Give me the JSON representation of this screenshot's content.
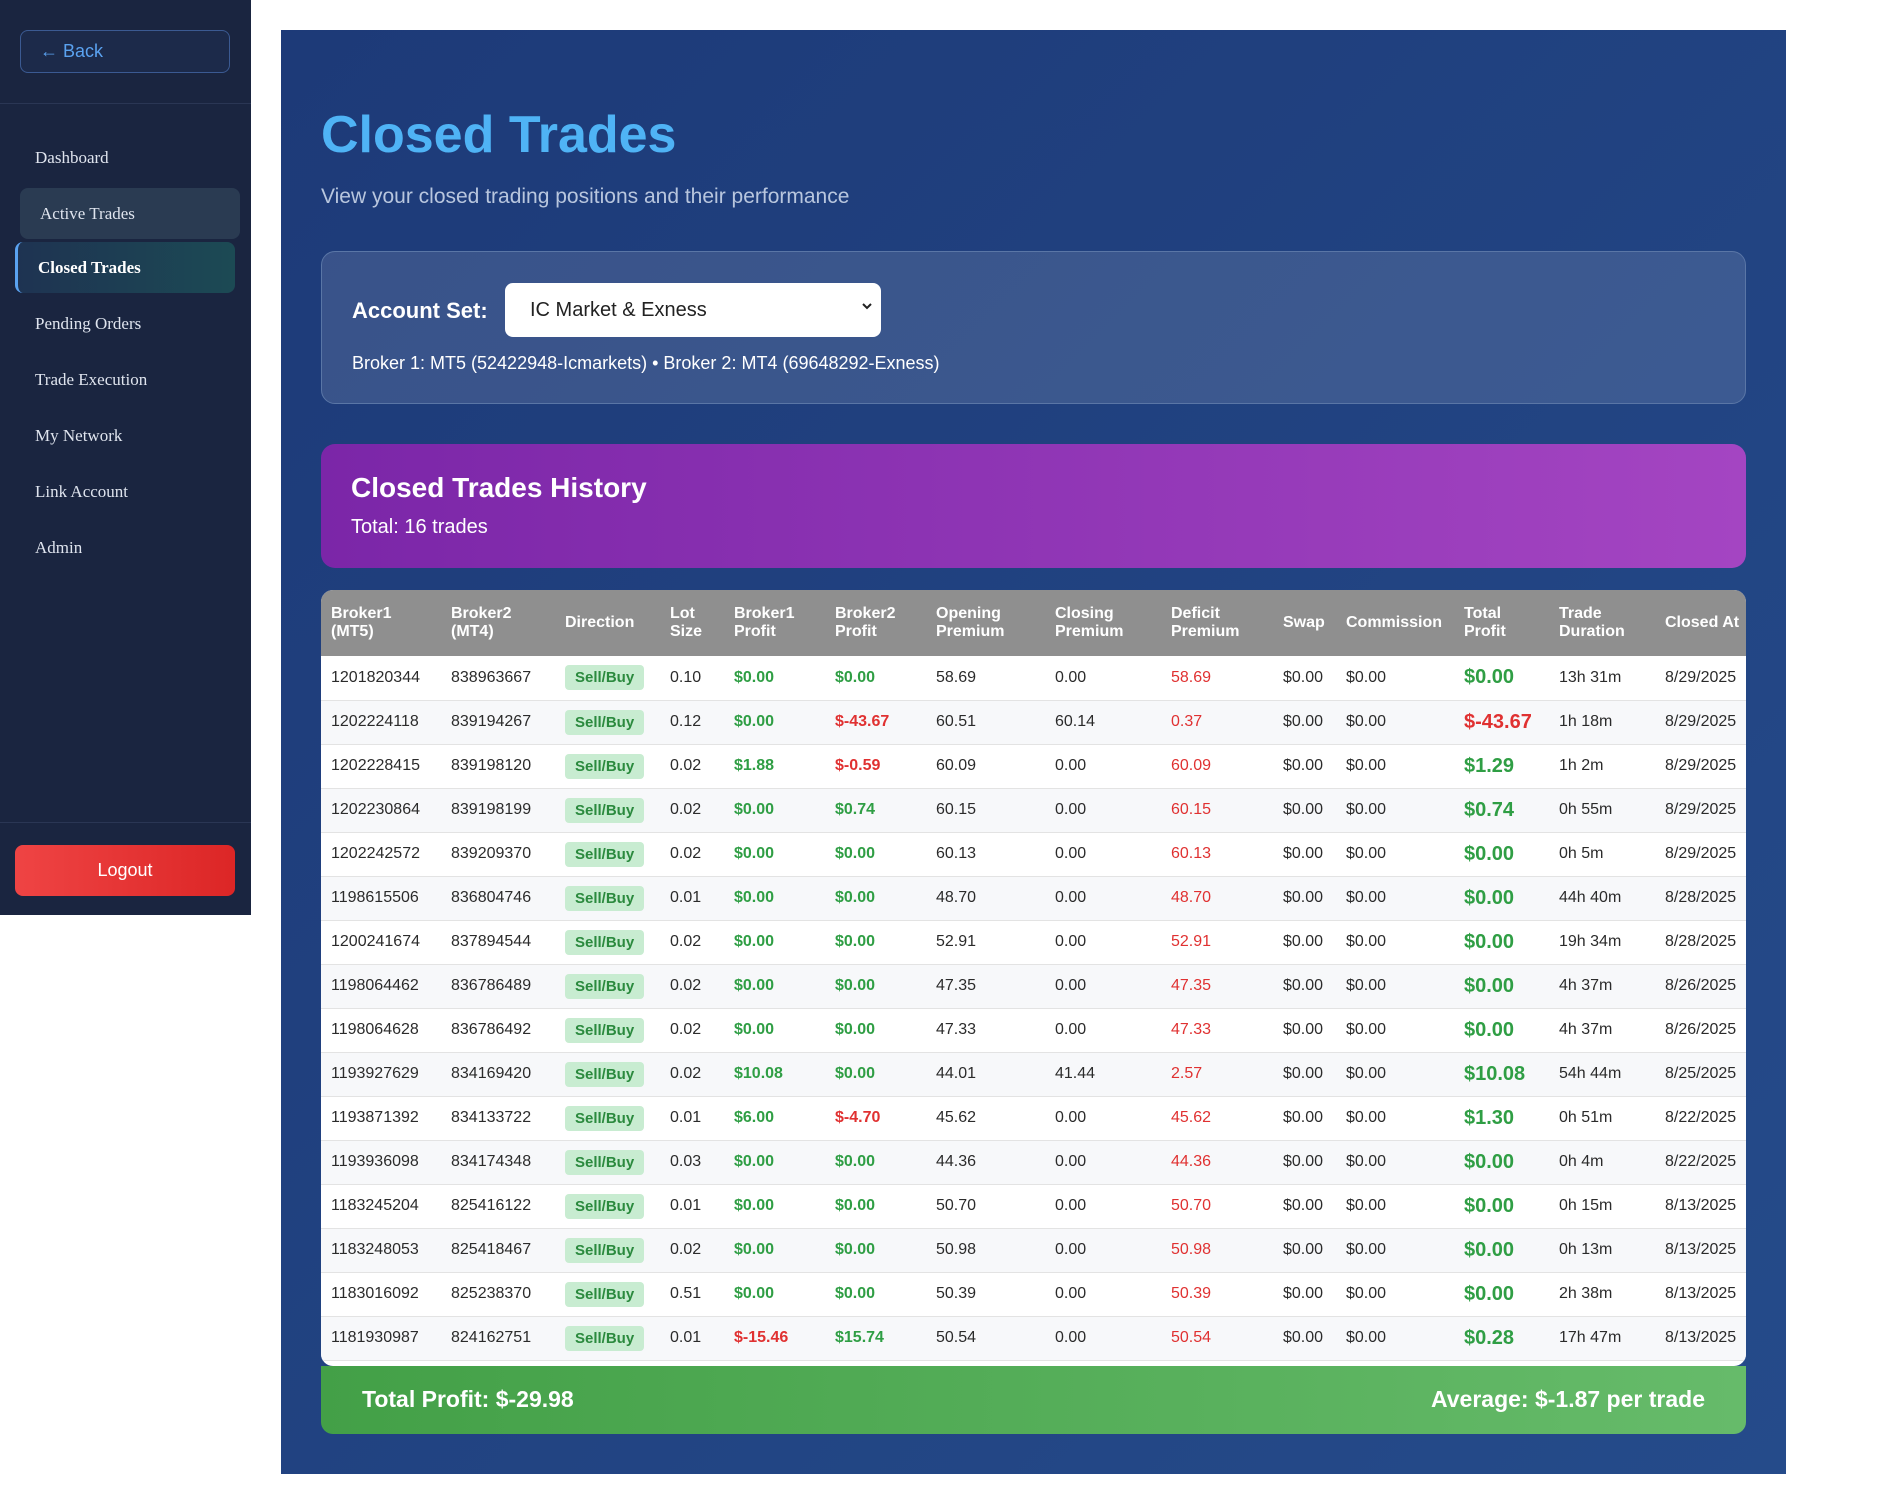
{
  "sidebar": {
    "back_label": "← Back",
    "items": [
      {
        "label": "Dashboard",
        "state": "normal"
      },
      {
        "label": "Active Trades",
        "state": "hover"
      },
      {
        "label": "Closed Trades",
        "state": "active"
      },
      {
        "label": "Pending Orders",
        "state": "normal"
      },
      {
        "label": "Trade Execution",
        "state": "normal"
      },
      {
        "label": "My Network",
        "state": "normal"
      },
      {
        "label": "Link Account",
        "state": "normal"
      },
      {
        "label": "Admin",
        "state": "normal"
      }
    ],
    "logout_label": "Logout"
  },
  "header": {
    "title": "Closed Trades",
    "subtitle": "View your closed trading positions and their performance"
  },
  "account": {
    "label": "Account Set:",
    "selected": "IC Market & Exness",
    "broker_info": "Broker 1: MT5 (52422948-Icmarkets) • Broker 2: MT4 (69648292-Exness)"
  },
  "history": {
    "title": "Closed Trades History",
    "total": "Total: 16 trades"
  },
  "table": {
    "columns": [
      {
        "l1": "Broker1",
        "l2": "(MT5)"
      },
      {
        "l1": "Broker2",
        "l2": "(MT4)"
      },
      {
        "l1": "Direction",
        "l2": ""
      },
      {
        "l1": "Lot",
        "l2": "Size"
      },
      {
        "l1": "Broker1",
        "l2": "Profit"
      },
      {
        "l1": "Broker2",
        "l2": "Profit"
      },
      {
        "l1": "Opening",
        "l2": "Premium"
      },
      {
        "l1": "Closing",
        "l2": "Premium"
      },
      {
        "l1": "Deficit",
        "l2": "Premium"
      },
      {
        "l1": "Swap",
        "l2": ""
      },
      {
        "l1": "Commission",
        "l2": ""
      },
      {
        "l1": "Total",
        "l2": "Profit"
      },
      {
        "l1": "Trade",
        "l2": "Duration"
      },
      {
        "l1": "Closed At",
        "l2": ""
      }
    ],
    "rows": [
      {
        "b1": "1201820344",
        "b2": "838963667",
        "dir": "Sell/Buy",
        "lot": "0.10",
        "p1": "$0.00",
        "p2": "$0.00",
        "open": "58.69",
        "close": "0.00",
        "deficit": "58.69",
        "swap": "$0.00",
        "comm": "$0.00",
        "total": "$0.00",
        "dur": "13h 31m",
        "at": "8/29/2025"
      },
      {
        "b1": "1202224118",
        "b2": "839194267",
        "dir": "Sell/Buy",
        "lot": "0.12",
        "p1": "$0.00",
        "p2": "$-43.67",
        "open": "60.51",
        "close": "60.14",
        "deficit": "0.37",
        "swap": "$0.00",
        "comm": "$0.00",
        "total": "$-43.67",
        "dur": "1h 18m",
        "at": "8/29/2025"
      },
      {
        "b1": "1202228415",
        "b2": "839198120",
        "dir": "Sell/Buy",
        "lot": "0.02",
        "p1": "$1.88",
        "p2": "$-0.59",
        "open": "60.09",
        "close": "0.00",
        "deficit": "60.09",
        "swap": "$0.00",
        "comm": "$0.00",
        "total": "$1.29",
        "dur": "1h 2m",
        "at": "8/29/2025"
      },
      {
        "b1": "1202230864",
        "b2": "839198199",
        "dir": "Sell/Buy",
        "lot": "0.02",
        "p1": "$0.00",
        "p2": "$0.74",
        "open": "60.15",
        "close": "0.00",
        "deficit": "60.15",
        "swap": "$0.00",
        "comm": "$0.00",
        "total": "$0.74",
        "dur": "0h 55m",
        "at": "8/29/2025"
      },
      {
        "b1": "1202242572",
        "b2": "839209370",
        "dir": "Sell/Buy",
        "lot": "0.02",
        "p1": "$0.00",
        "p2": "$0.00",
        "open": "60.13",
        "close": "0.00",
        "deficit": "60.13",
        "swap": "$0.00",
        "comm": "$0.00",
        "total": "$0.00",
        "dur": "0h 5m",
        "at": "8/29/2025"
      },
      {
        "b1": "1198615506",
        "b2": "836804746",
        "dir": "Sell/Buy",
        "lot": "0.01",
        "p1": "$0.00",
        "p2": "$0.00",
        "open": "48.70",
        "close": "0.00",
        "deficit": "48.70",
        "swap": "$0.00",
        "comm": "$0.00",
        "total": "$0.00",
        "dur": "44h 40m",
        "at": "8/28/2025"
      },
      {
        "b1": "1200241674",
        "b2": "837894544",
        "dir": "Sell/Buy",
        "lot": "0.02",
        "p1": "$0.00",
        "p2": "$0.00",
        "open": "52.91",
        "close": "0.00",
        "deficit": "52.91",
        "swap": "$0.00",
        "comm": "$0.00",
        "total": "$0.00",
        "dur": "19h 34m",
        "at": "8/28/2025"
      },
      {
        "b1": "1198064462",
        "b2": "836786489",
        "dir": "Sell/Buy",
        "lot": "0.02",
        "p1": "$0.00",
        "p2": "$0.00",
        "open": "47.35",
        "close": "0.00",
        "deficit": "47.35",
        "swap": "$0.00",
        "comm": "$0.00",
        "total": "$0.00",
        "dur": "4h 37m",
        "at": "8/26/2025"
      },
      {
        "b1": "1198064628",
        "b2": "836786492",
        "dir": "Sell/Buy",
        "lot": "0.02",
        "p1": "$0.00",
        "p2": "$0.00",
        "open": "47.33",
        "close": "0.00",
        "deficit": "47.33",
        "swap": "$0.00",
        "comm": "$0.00",
        "total": "$0.00",
        "dur": "4h 37m",
        "at": "8/26/2025"
      },
      {
        "b1": "1193927629",
        "b2": "834169420",
        "dir": "Sell/Buy",
        "lot": "0.02",
        "p1": "$10.08",
        "p2": "$0.00",
        "open": "44.01",
        "close": "41.44",
        "deficit": "2.57",
        "swap": "$0.00",
        "comm": "$0.00",
        "total": "$10.08",
        "dur": "54h 44m",
        "at": "8/25/2025"
      },
      {
        "b1": "1193871392",
        "b2": "834133722",
        "dir": "Sell/Buy",
        "lot": "0.01",
        "p1": "$6.00",
        "p2": "$-4.70",
        "open": "45.62",
        "close": "0.00",
        "deficit": "45.62",
        "swap": "$0.00",
        "comm": "$0.00",
        "total": "$1.30",
        "dur": "0h 51m",
        "at": "8/22/2025"
      },
      {
        "b1": "1193936098",
        "b2": "834174348",
        "dir": "Sell/Buy",
        "lot": "0.03",
        "p1": "$0.00",
        "p2": "$0.00",
        "open": "44.36",
        "close": "0.00",
        "deficit": "44.36",
        "swap": "$0.00",
        "comm": "$0.00",
        "total": "$0.00",
        "dur": "0h 4m",
        "at": "8/22/2025"
      },
      {
        "b1": "1183245204",
        "b2": "825416122",
        "dir": "Sell/Buy",
        "lot": "0.01",
        "p1": "$0.00",
        "p2": "$0.00",
        "open": "50.70",
        "close": "0.00",
        "deficit": "50.70",
        "swap": "$0.00",
        "comm": "$0.00",
        "total": "$0.00",
        "dur": "0h 15m",
        "at": "8/13/2025"
      },
      {
        "b1": "1183248053",
        "b2": "825418467",
        "dir": "Sell/Buy",
        "lot": "0.02",
        "p1": "$0.00",
        "p2": "$0.00",
        "open": "50.98",
        "close": "0.00",
        "deficit": "50.98",
        "swap": "$0.00",
        "comm": "$0.00",
        "total": "$0.00",
        "dur": "0h 13m",
        "at": "8/13/2025"
      },
      {
        "b1": "1183016092",
        "b2": "825238370",
        "dir": "Sell/Buy",
        "lot": "0.51",
        "p1": "$0.00",
        "p2": "$0.00",
        "open": "50.39",
        "close": "0.00",
        "deficit": "50.39",
        "swap": "$0.00",
        "comm": "$0.00",
        "total": "$0.00",
        "dur": "2h 38m",
        "at": "8/13/2025"
      },
      {
        "b1": "1181930987",
        "b2": "824162751",
        "dir": "Sell/Buy",
        "lot": "0.01",
        "p1": "$-15.46",
        "p2": "$15.74",
        "open": "50.54",
        "close": "0.00",
        "deficit": "50.54",
        "swap": "$0.00",
        "comm": "$0.00",
        "total": "$0.28",
        "dur": "17h 47m",
        "at": "8/13/2025"
      }
    ]
  },
  "summary": {
    "total_profit": "Total Profit: $-29.98",
    "average": "Average: $-1.87 per trade"
  },
  "colors": {
    "accent": "#4fb3f5",
    "positive": "#2f9e44",
    "negative": "#e03131",
    "sidebar_bg": "#1a2540",
    "logout": "#ef4444"
  }
}
